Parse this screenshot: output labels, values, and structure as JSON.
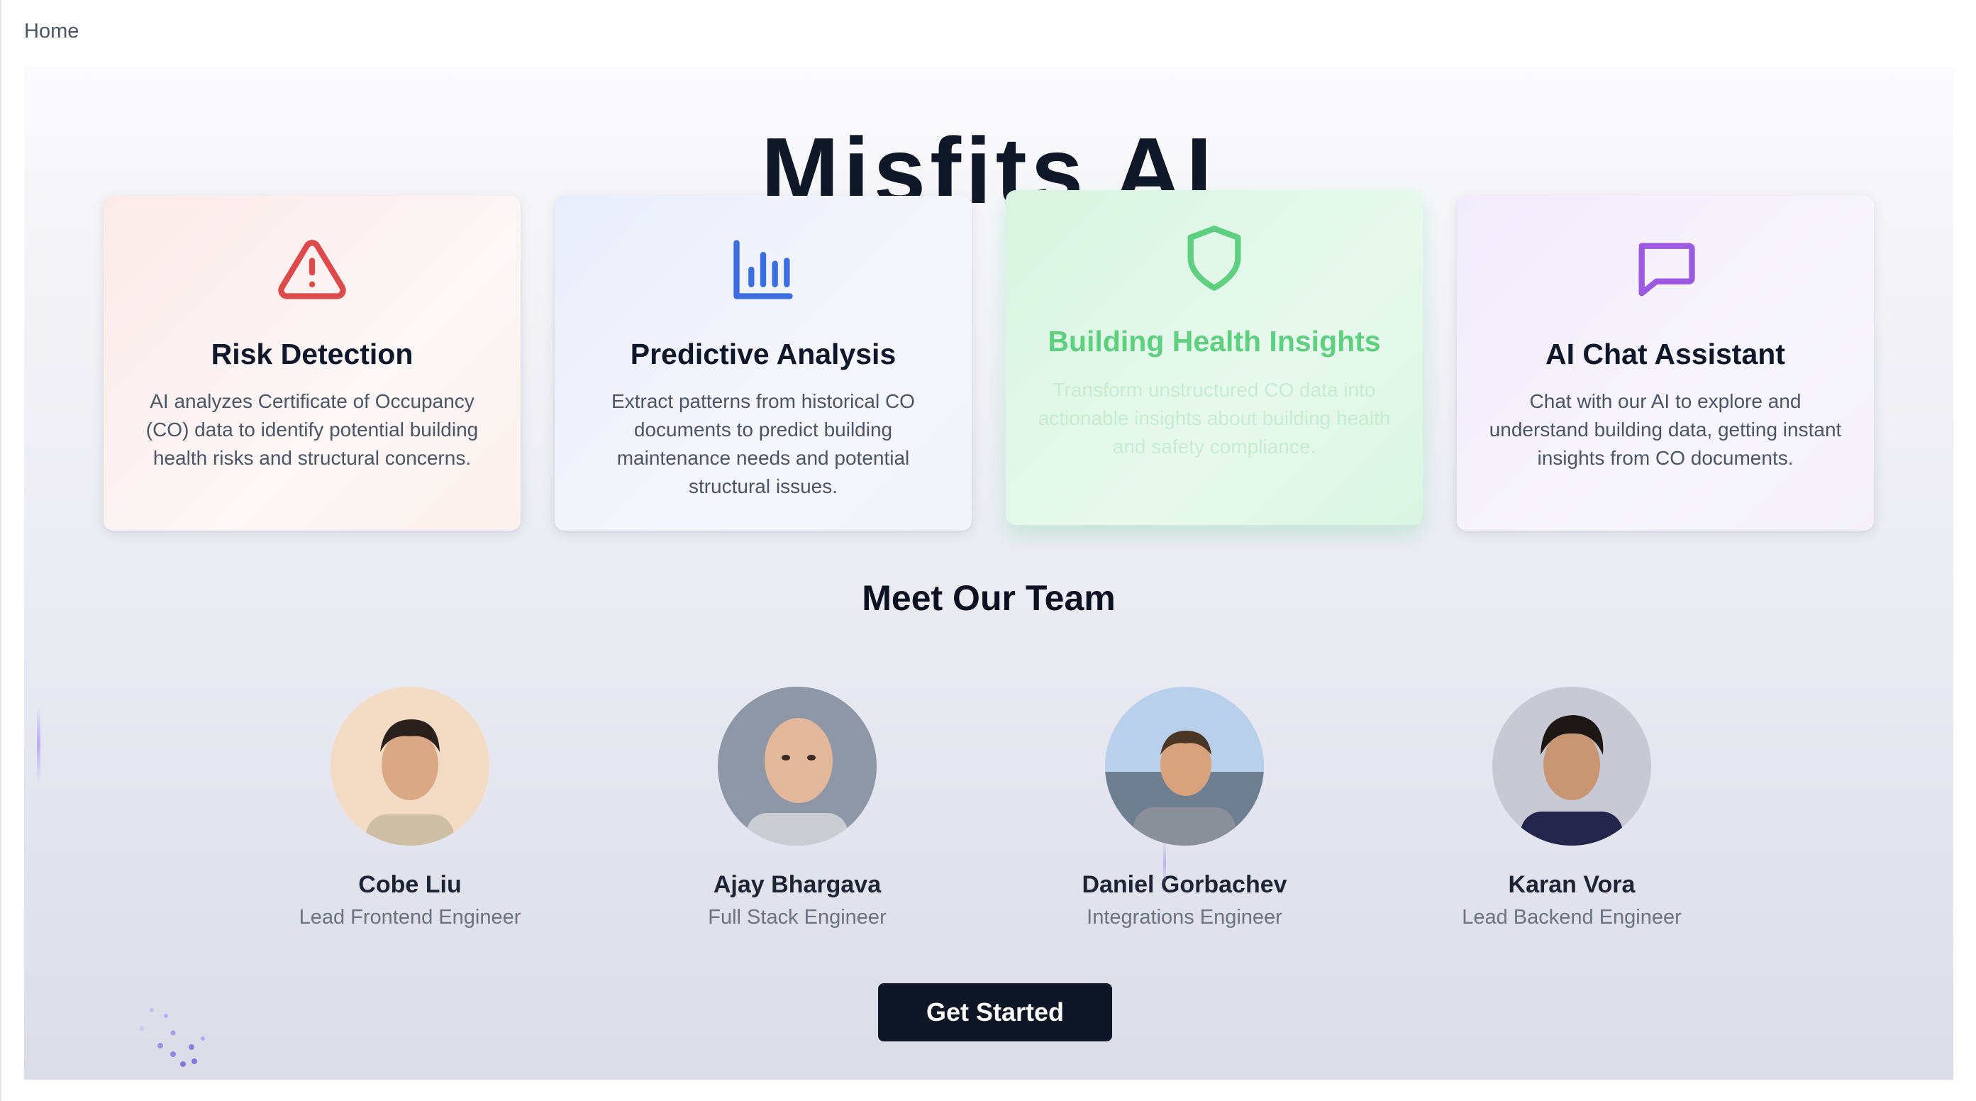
{
  "nav": {
    "home_label": "Home"
  },
  "hero": {
    "title": "Misfits AI"
  },
  "features": [
    {
      "title": "Risk Detection",
      "description": "AI analyzes Certificate of Occupancy (CO) data to identify potential building health risks and structural concerns.",
      "icon": "warning-triangle-icon",
      "color": "#dc4a4a"
    },
    {
      "title": "Predictive Analysis",
      "description": "Extract patterns from historical CO documents to predict building maintenance needs and potential structural issues.",
      "icon": "bar-chart-icon",
      "color": "#3b6fe0"
    },
    {
      "title": "Building Health Insights",
      "description": "Transform unstructured CO data into actionable insights about building health and safety compliance.",
      "icon": "shield-icon",
      "color": "#5ed07f"
    },
    {
      "title": "AI Chat Assistant",
      "description": "Chat with our AI to explore and understand building data, getting instant insights from CO documents.",
      "icon": "chat-bubble-icon",
      "color": "#9b5ae0"
    }
  ],
  "team": {
    "heading": "Meet Our Team",
    "members": [
      {
        "name": "Cobe Liu",
        "role": "Lead Frontend Engineer"
      },
      {
        "name": "Ajay Bhargava",
        "role": "Full Stack Engineer"
      },
      {
        "name": "Daniel Gorbachev",
        "role": "Integrations Engineer"
      },
      {
        "name": "Karan Vora",
        "role": "Lead Backend Engineer"
      }
    ]
  },
  "cta": {
    "label": "Get Started"
  },
  "colors": {
    "primary_button": "#0f1626",
    "title_text": "#101828"
  }
}
